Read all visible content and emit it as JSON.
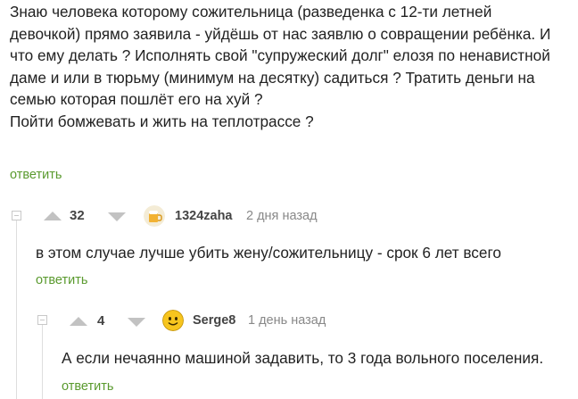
{
  "root": {
    "lines": [
      "Знаю человека которому сожительница (разведенка с 12-ти летней",
      "девочкой) прямо заявила - уйдёшь от нас заявлю о совращении ребёнка. И",
      "что ему делать ? Исполнять свой \"супружеский долг\" елозя по ненавистной",
      "даме и или в тюрьму (минимум на десятку) садиться ? Тратить деньги на",
      "семью которая пошлёт его на хуй ?",
      "Пойти бомжевать и жить на теплотрассе ?"
    ],
    "reply_label": "ответить"
  },
  "comments": [
    {
      "rating": "32",
      "author": "1324zaha",
      "time": "2 дня назад",
      "text": "в этом случае лучше убить жену/сожительницу - срок 6 лет всего",
      "reply_label": "ответить",
      "avatar_icon": "beer-mug-icon"
    },
    {
      "rating": "4",
      "author": "Serge8",
      "time": "1 день назад",
      "text": "А если нечаянно машиной задавить, то 3 года вольного поселения.",
      "reply_label": "ответить",
      "avatar_icon": "smiley-face-icon"
    }
  ],
  "colors": {
    "accent_green": "#5a9a2e",
    "arrow_gray": "#c2c2c2",
    "line_gray": "#dedede"
  }
}
